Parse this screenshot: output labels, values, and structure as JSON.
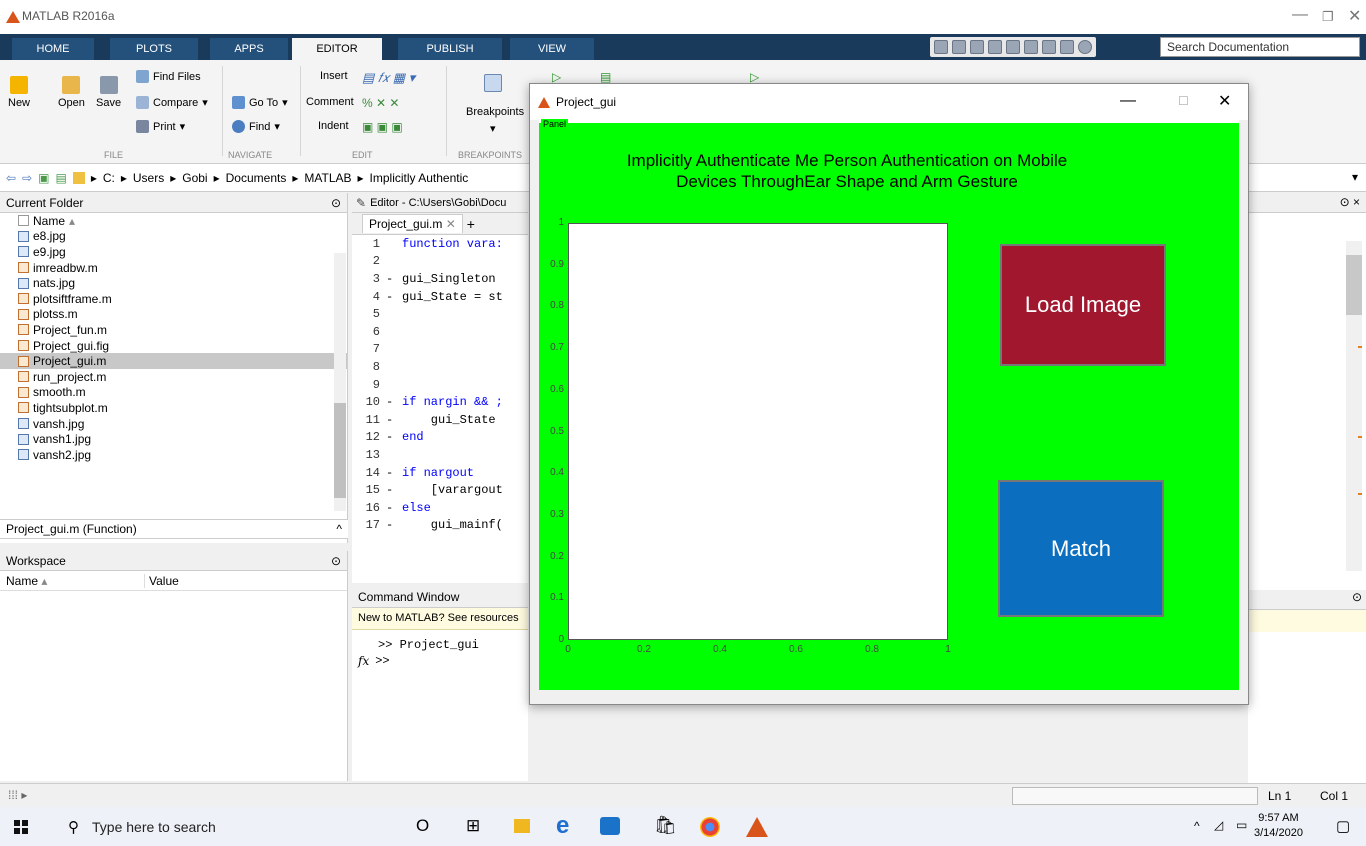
{
  "app": {
    "title": "MATLAB R2016a"
  },
  "ribbon_tabs": [
    "HOME",
    "PLOTS",
    "APPS",
    "EDITOR",
    "PUBLISH",
    "VIEW"
  ],
  "active_tab": "EDITOR",
  "search_doc": {
    "placeholder": "Search Documentation"
  },
  "file_group": {
    "new": "New",
    "open": "Open",
    "save": "Save",
    "label": "FILE"
  },
  "navigate_group": {
    "find_files": "Find Files",
    "compare": "Compare",
    "print": "Print",
    "go_to": "Go To",
    "find": "Find",
    "label": "NAVIGATE"
  },
  "edit_group": {
    "insert": "Insert",
    "comment": "Comment",
    "indent": "Indent",
    "label": "EDIT"
  },
  "breakpoints_group": {
    "breakpoints": "Breakpoints",
    "label": "BREAKPOINTS"
  },
  "address": {
    "crumbs": [
      "C:",
      "Users",
      "Gobi",
      "Documents",
      "MATLAB",
      "Implicitly Authentic"
    ]
  },
  "current_folder": {
    "title": "Current Folder",
    "col_name": "Name",
    "files": [
      "e8.jpg",
      "e9.jpg",
      "imreadbw.m",
      "nats.jpg",
      "plotsiftframe.m",
      "plotss.m",
      "Project_fun.m",
      "Project_gui.fig",
      "Project_gui.m",
      "run_project.m",
      "smooth.m",
      "tightsubplot.m",
      "vansh.jpg",
      "vansh1.jpg",
      "vansh2.jpg"
    ],
    "selected": "Project_gui.m",
    "details": "Project_gui.m  (Function)"
  },
  "workspace": {
    "title": "Workspace",
    "col_name": "Name",
    "col_value": "Value"
  },
  "editor": {
    "header": "Editor - C:\\Users\\Gobi\\Docu",
    "tab": "Project_gui.m",
    "lines": [
      {
        "n": "1",
        "dash": "",
        "code": "function vara:"
      },
      {
        "n": "2",
        "dash": "",
        "code": ""
      },
      {
        "n": "3",
        "dash": "-",
        "code": "gui_Singleton"
      },
      {
        "n": "4",
        "dash": "-",
        "code": "gui_State = st"
      },
      {
        "n": "5",
        "dash": "",
        "code": ""
      },
      {
        "n": "6",
        "dash": "",
        "code": ""
      },
      {
        "n": "7",
        "dash": "",
        "code": ""
      },
      {
        "n": "8",
        "dash": "",
        "code": ""
      },
      {
        "n": "9",
        "dash": "",
        "code": ""
      },
      {
        "n": "10",
        "dash": "-",
        "code": "if nargin && ;"
      },
      {
        "n": "11",
        "dash": "-",
        "code": "    gui_State"
      },
      {
        "n": "12",
        "dash": "-",
        "code": "end"
      },
      {
        "n": "13",
        "dash": "",
        "code": ""
      },
      {
        "n": "14",
        "dash": "-",
        "code": "if nargout"
      },
      {
        "n": "15",
        "dash": "-",
        "code": "    [varargout"
      },
      {
        "n": "16",
        "dash": "-",
        "code": "else"
      },
      {
        "n": "17",
        "dash": "-",
        "code": "    gui_mainf("
      }
    ]
  },
  "command_window": {
    "title": "Command Window",
    "banner": "New to MATLAB? See resources",
    "history": ">> Project_gui",
    "prompt": ">>",
    "fx": "fx"
  },
  "gui": {
    "window_title": "Project_gui",
    "panel_label": "Panel",
    "heading_line1": "Implicitly Authenticate Me Person Authentication on Mobile",
    "heading_line2": "Devices ThroughEar Shape and Arm Gesture",
    "load_button": "Load Image",
    "match_button": "Match"
  },
  "chart_data": {
    "type": "scatter",
    "title": "",
    "xlabel": "",
    "ylabel": "",
    "xlim": [
      0,
      1
    ],
    "ylim": [
      0,
      1
    ],
    "x_ticks": [
      "0",
      "0.2",
      "0.4",
      "0.6",
      "0.8",
      "1"
    ],
    "y_ticks": [
      "0",
      "0.1",
      "0.2",
      "0.3",
      "0.4",
      "0.5",
      "0.6",
      "0.7",
      "0.8",
      "0.9",
      "1"
    ],
    "series": []
  },
  "status": {
    "ln": "Ln  1",
    "col": "Col  1"
  },
  "taskbar": {
    "search": "Type here to search",
    "time": "9:57 AM",
    "date": "3/14/2020"
  },
  "colors": {
    "panel": "#00ff00",
    "load_button": "#a0172e",
    "match_button": "#0b6ebe",
    "ribbon_dark": "#1a3a5c"
  }
}
